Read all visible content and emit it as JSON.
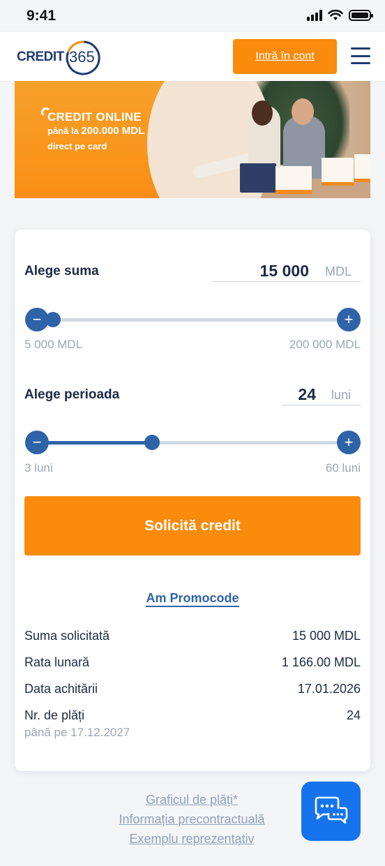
{
  "status_bar": {
    "time": "9:41"
  },
  "header": {
    "logo_text": "CREDIT",
    "logo_number": "365",
    "login_label": "Intră în cont"
  },
  "banner": {
    "line1": "CREDIT ONLINE",
    "line2_prefix": "până la",
    "line2_amount": "200.000 MDL",
    "line3": "direct pe card"
  },
  "calculator": {
    "amount": {
      "label": "Alege suma",
      "value": "15 000",
      "unit": "MDL",
      "min_label": "5 000 MDL",
      "max_label": "200 000 MDL",
      "min": 5000,
      "max": 200000,
      "current": 15000
    },
    "period": {
      "label": "Alege perioada",
      "value": "24",
      "unit": "luni",
      "min_label": "3 luni",
      "max_label": "60 luni",
      "min": 3,
      "max": 60,
      "current": 24
    },
    "apply_label": "Solicită credit",
    "promo_label": "Am Promocode",
    "summary": [
      {
        "label": "Suma solicitată",
        "value": "15 000 MDL"
      },
      {
        "label": "Rata lunară",
        "value": "1 166.00 MDL"
      },
      {
        "label": "Data achitării",
        "value": "17.01.2026"
      },
      {
        "label": "Nr. de plăți",
        "value": "24"
      }
    ],
    "until_note": "până pe 17.12.2027"
  },
  "footer_links": [
    "Graficul de plăți*",
    "Informația precontractuală",
    "Exemplu reprezentativ"
  ],
  "colors": {
    "accent": "#fb8b0c",
    "primary": "#2e63a8",
    "chat": "#1573ed"
  }
}
